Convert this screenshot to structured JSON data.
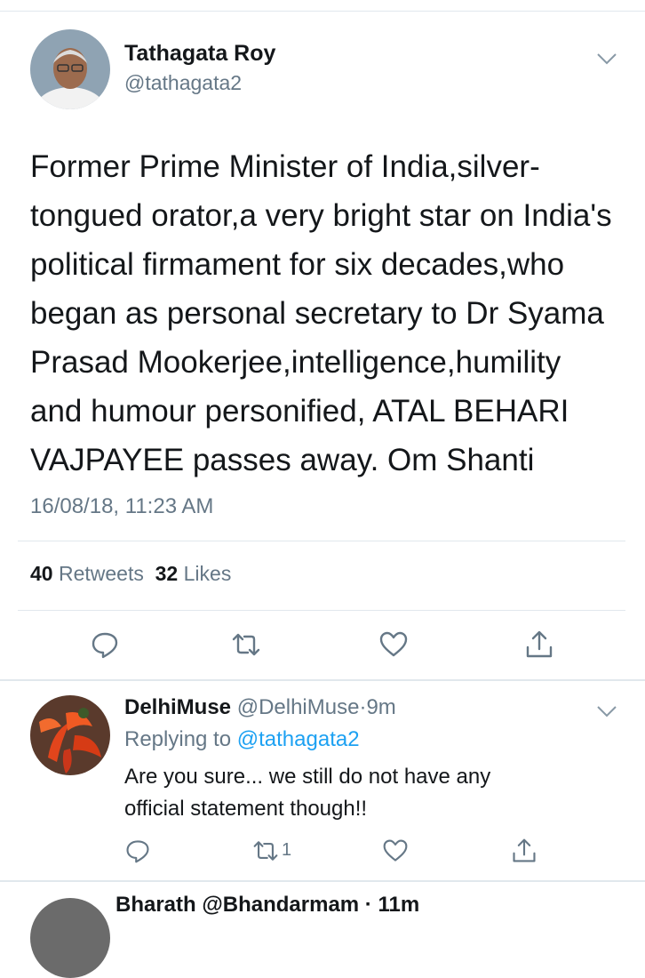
{
  "tweet": {
    "name": "Tathagata Roy",
    "handle": "@tathagata2",
    "text": "Former Prime Minister of India,silver-\ntongued orator,a very bright star on India's\npolitical firmament for six decades,who\nbegan as personal secretary to Dr Syama\nPrasad Mookerjee,intelligence,humility\nand humour  personified, ATAL BEHARI\nVAJPAYEE passes away. Om Shanti",
    "timestamp": "16/08/18, 11:23 AM",
    "retweets_count": "40",
    "retweets_label": "Retweets",
    "likes_count": "32",
    "likes_label": "Likes"
  },
  "reply": {
    "name": "DelhiMuse",
    "handle": "@DelhiMuse",
    "separator": "·",
    "time": "9m",
    "replying_prefix": "Replying to",
    "replying_to": "@tathagata2",
    "text": "Are you sure... we still do not have any\nofficial statement though!!",
    "retweet_count": "1"
  },
  "next_reply": {
    "name_partial": "Bharath  @Bhandarmam · 11m"
  },
  "icons": {
    "reply": "reply-icon",
    "retweet": "retweet-icon",
    "like": "heart-icon",
    "share": "share-icon",
    "more": "chevron-down-icon"
  },
  "colors": {
    "accent": "#1da1f2",
    "secondary_text": "#657786",
    "primary_text": "#14171a",
    "divider": "#e1e8ed"
  }
}
